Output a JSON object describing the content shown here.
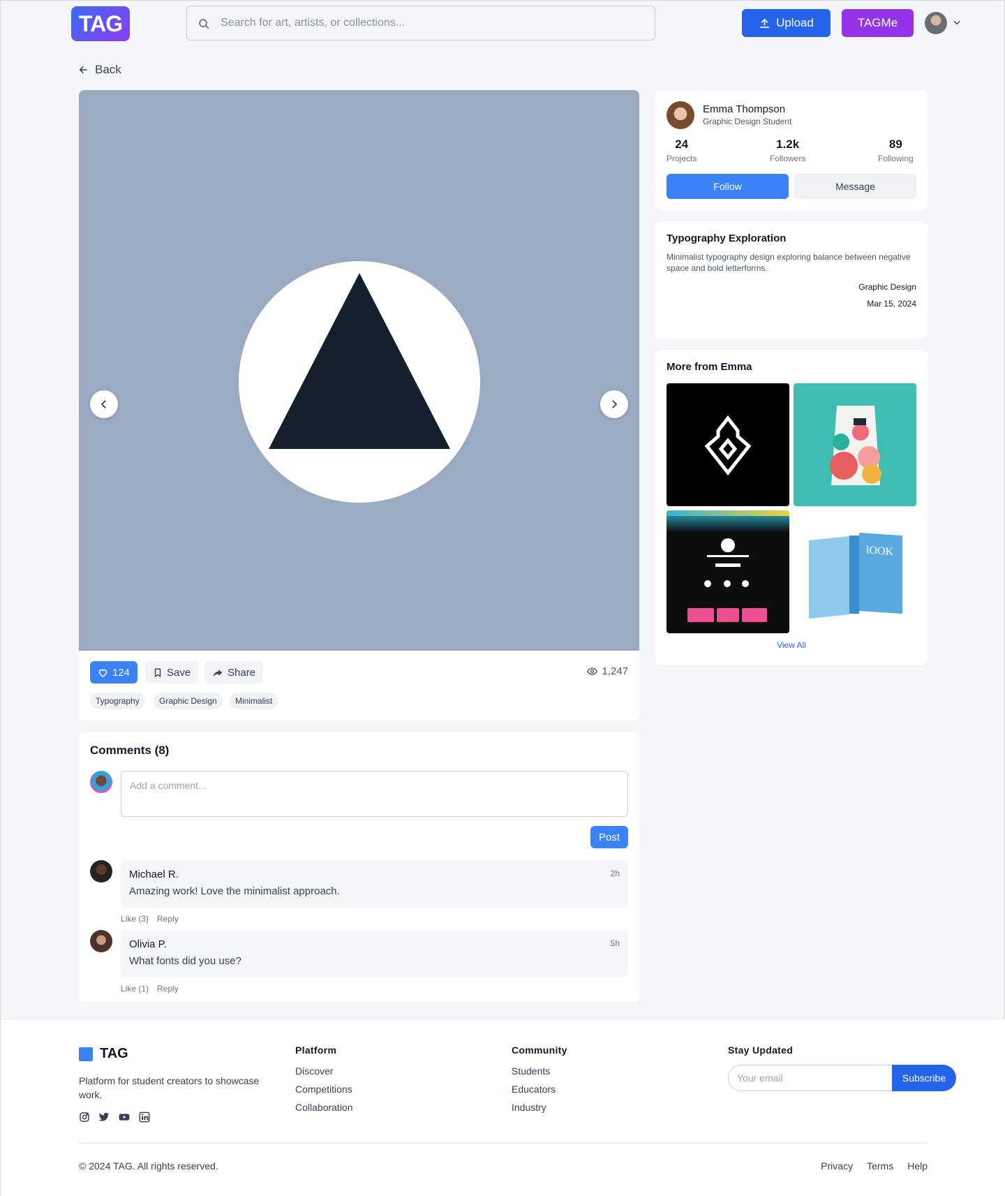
{
  "header": {
    "logo": "TAG",
    "search_placeholder": "Search for art, artists, or collections...",
    "upload_label": "Upload",
    "tagme_label": "TAGMe"
  },
  "nav": {
    "back_label": "Back"
  },
  "artwork": {
    "likes": "124",
    "save_label": "Save",
    "share_label": "Share",
    "views": "1,247",
    "tags": [
      "Typography",
      "Graphic Design",
      "Minimalist"
    ]
  },
  "comments": {
    "title": "Comments (8)",
    "placeholder": "Add a comment...",
    "post_label": "Post",
    "items": [
      {
        "name": "Michael R.",
        "time": "2h",
        "text": "Amazing work! Love the minimalist approach.",
        "like": "Like (3)",
        "reply": "Reply"
      },
      {
        "name": "Olivia P.",
        "time": "5h",
        "text": "What fonts did you use?",
        "like": "Like (1)",
        "reply": "Reply"
      }
    ]
  },
  "profile": {
    "name": "Emma Thompson",
    "role": "Graphic Design Student",
    "stats": [
      {
        "value": "24",
        "label": "Projects"
      },
      {
        "value": "1.2k",
        "label": "Followers"
      },
      {
        "value": "89",
        "label": "Following"
      }
    ],
    "follow_label": "Follow",
    "message_label": "Message"
  },
  "info": {
    "title": "Typography Exploration",
    "description": "Minimalist typography design exploring balance between negative space and bold letterforms.",
    "category": "Graphic Design",
    "date": "Mar 15, 2024"
  },
  "more": {
    "title": "More from Emma",
    "view_all": "View All",
    "thumbs": [
      "logo-mark-thumbnail",
      "packaging-thumbnail",
      "website-thumbnail",
      "book-thumbnail"
    ],
    "book_title": "lOOK"
  },
  "footer": {
    "brand": "TAG",
    "description": "Platform for student creators to showcase work.",
    "columns": [
      {
        "title": "Platform",
        "links": [
          "Discover",
          "Competitions",
          "Collaboration"
        ]
      },
      {
        "title": "Community",
        "links": [
          "Students",
          "Educators",
          "Industry"
        ]
      }
    ],
    "newsletter_title": "Stay Updated",
    "email_placeholder": "Your email",
    "subscribe_label": "Subscribe",
    "copyright": "© 2024 TAG. All rights reserved.",
    "legal_links": [
      "Privacy",
      "Terms",
      "Help"
    ]
  },
  "colors": {
    "primary": "#3b82f6",
    "upload": "#2563eb",
    "tagme": "#9333ea",
    "artwork_bg": "#9aaac0",
    "triangle": "#14202e"
  }
}
